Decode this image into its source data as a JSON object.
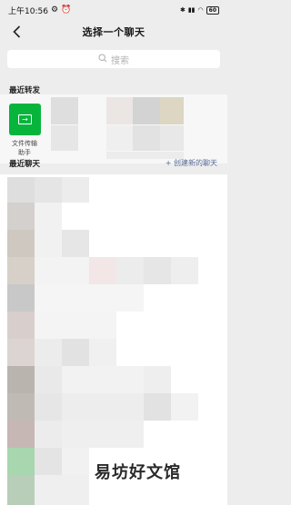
{
  "status_bar": {
    "time": "上午10:56",
    "status_icons": [
      "gear-icon",
      "alarm-icon"
    ],
    "right_icons": [
      "bluetooth-icon",
      "signal-icon",
      "wifi-icon"
    ],
    "battery": "60"
  },
  "nav": {
    "title": "选择一个聊天",
    "back_icon": "chevron-left-icon"
  },
  "search": {
    "placeholder": "搜索",
    "icon": "search-icon"
  },
  "recent_forward": {
    "label": "最近转发",
    "items": [
      {
        "name": "文件传输\n助手",
        "icon": "file-transfer-icon",
        "color": "#07b53d"
      }
    ]
  },
  "recent_chats": {
    "label": "最近聊天",
    "create_link": "+ 创建新的聊天"
  },
  "watermark": "易坊好文馆",
  "colors": {
    "background": "#ededed",
    "link": "#576b95",
    "brand_green": "#07b53d"
  }
}
